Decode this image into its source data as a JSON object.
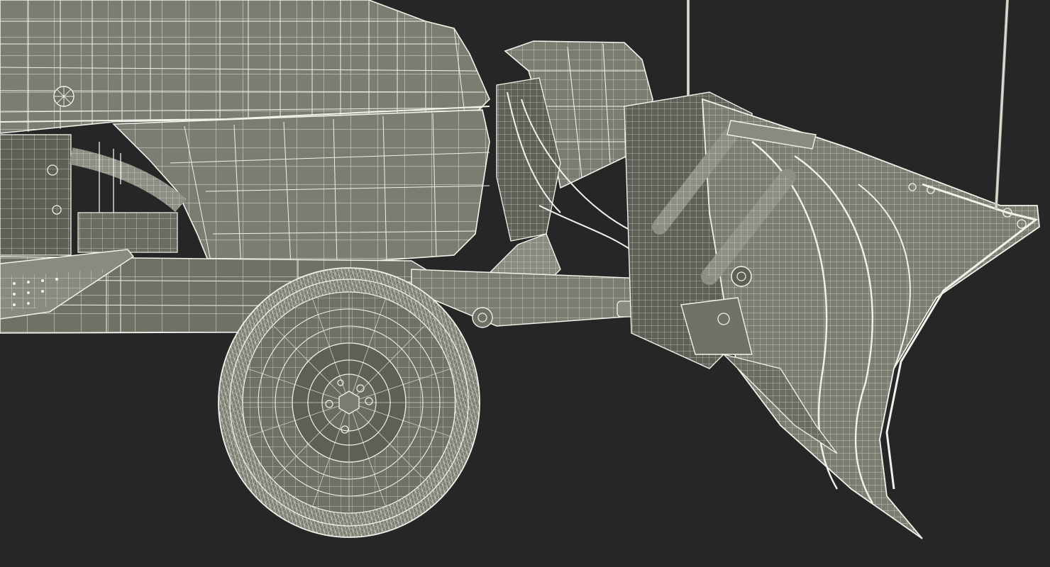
{
  "scene": {
    "background": "#262626",
    "mesh_fill": "#7c7d72",
    "mesh_fill_dark": "#5e5f56",
    "mesh_fill_light": "#8e8f84",
    "wire_color": "#f2f2ea",
    "shadow_color": "#3a3a36",
    "parts": [
      "hood",
      "fender",
      "side-frame",
      "footrest",
      "headlight",
      "hydraulic-linkage",
      "front-wheel",
      "plow-blade",
      "antenna-left",
      "antenna-right"
    ]
  }
}
